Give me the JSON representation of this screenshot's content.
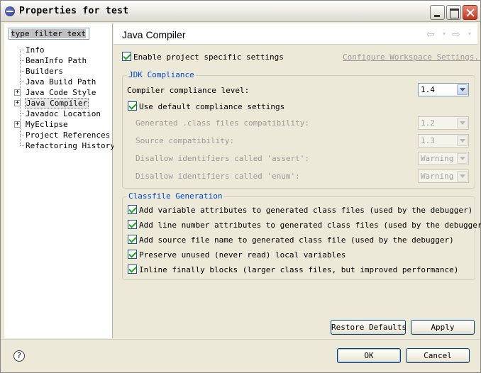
{
  "window": {
    "title": "Properties for test"
  },
  "filter": {
    "placeholder": "type filter text"
  },
  "tree": [
    {
      "label": "Info",
      "expandable": false,
      "selected": false
    },
    {
      "label": "BeanInfo Path",
      "expandable": false,
      "selected": false
    },
    {
      "label": "Builders",
      "expandable": false,
      "selected": false
    },
    {
      "label": "Java Build Path",
      "expandable": false,
      "selected": false
    },
    {
      "label": "Java Code Style",
      "expandable": true,
      "selected": false
    },
    {
      "label": "Java Compiler",
      "expandable": true,
      "selected": true
    },
    {
      "label": "Javadoc Location",
      "expandable": false,
      "selected": false
    },
    {
      "label": "MyEclipse",
      "expandable": true,
      "selected": false
    },
    {
      "label": "Project References",
      "expandable": false,
      "selected": false
    },
    {
      "label": "Refactoring History",
      "expandable": false,
      "selected": false
    }
  ],
  "page": {
    "title": "Java Compiler",
    "enable_project_specific": "Enable project specific settings",
    "configure_workspace": "Configure Workspace Settings..."
  },
  "jdk": {
    "group_title": "JDK Compliance",
    "compliance_label": "Compiler compliance level:",
    "compliance_value": "1.4",
    "use_default": "Use default compliance settings",
    "generated_label": "Generated .class files compatibility:",
    "generated_value": "1.2",
    "source_label": "Source compatibility:",
    "source_value": "1.3",
    "assert_label": "Disallow identifiers called 'assert':",
    "assert_value": "Warning",
    "enum_label": "Disallow identifiers called 'enum':",
    "enum_value": "Warning"
  },
  "classfile": {
    "group_title": "Classfile Generation",
    "options": [
      "Add variable attributes to generated class files (used by the debugger)",
      "Add line number attributes to generated class files (used by the debugger)",
      "Add source file name to generated class file (used by the debugger)",
      "Preserve unused (never read) local variables",
      "Inline finally blocks (larger class files, but improved performance)"
    ]
  },
  "buttons": {
    "restore_defaults": "Restore Defaults",
    "apply": "Apply",
    "ok": "OK",
    "cancel": "Cancel"
  },
  "icons": {
    "help": "?",
    "back": "⇦",
    "forward": "⇨",
    "dropdown": "▾",
    "expand": "+"
  }
}
